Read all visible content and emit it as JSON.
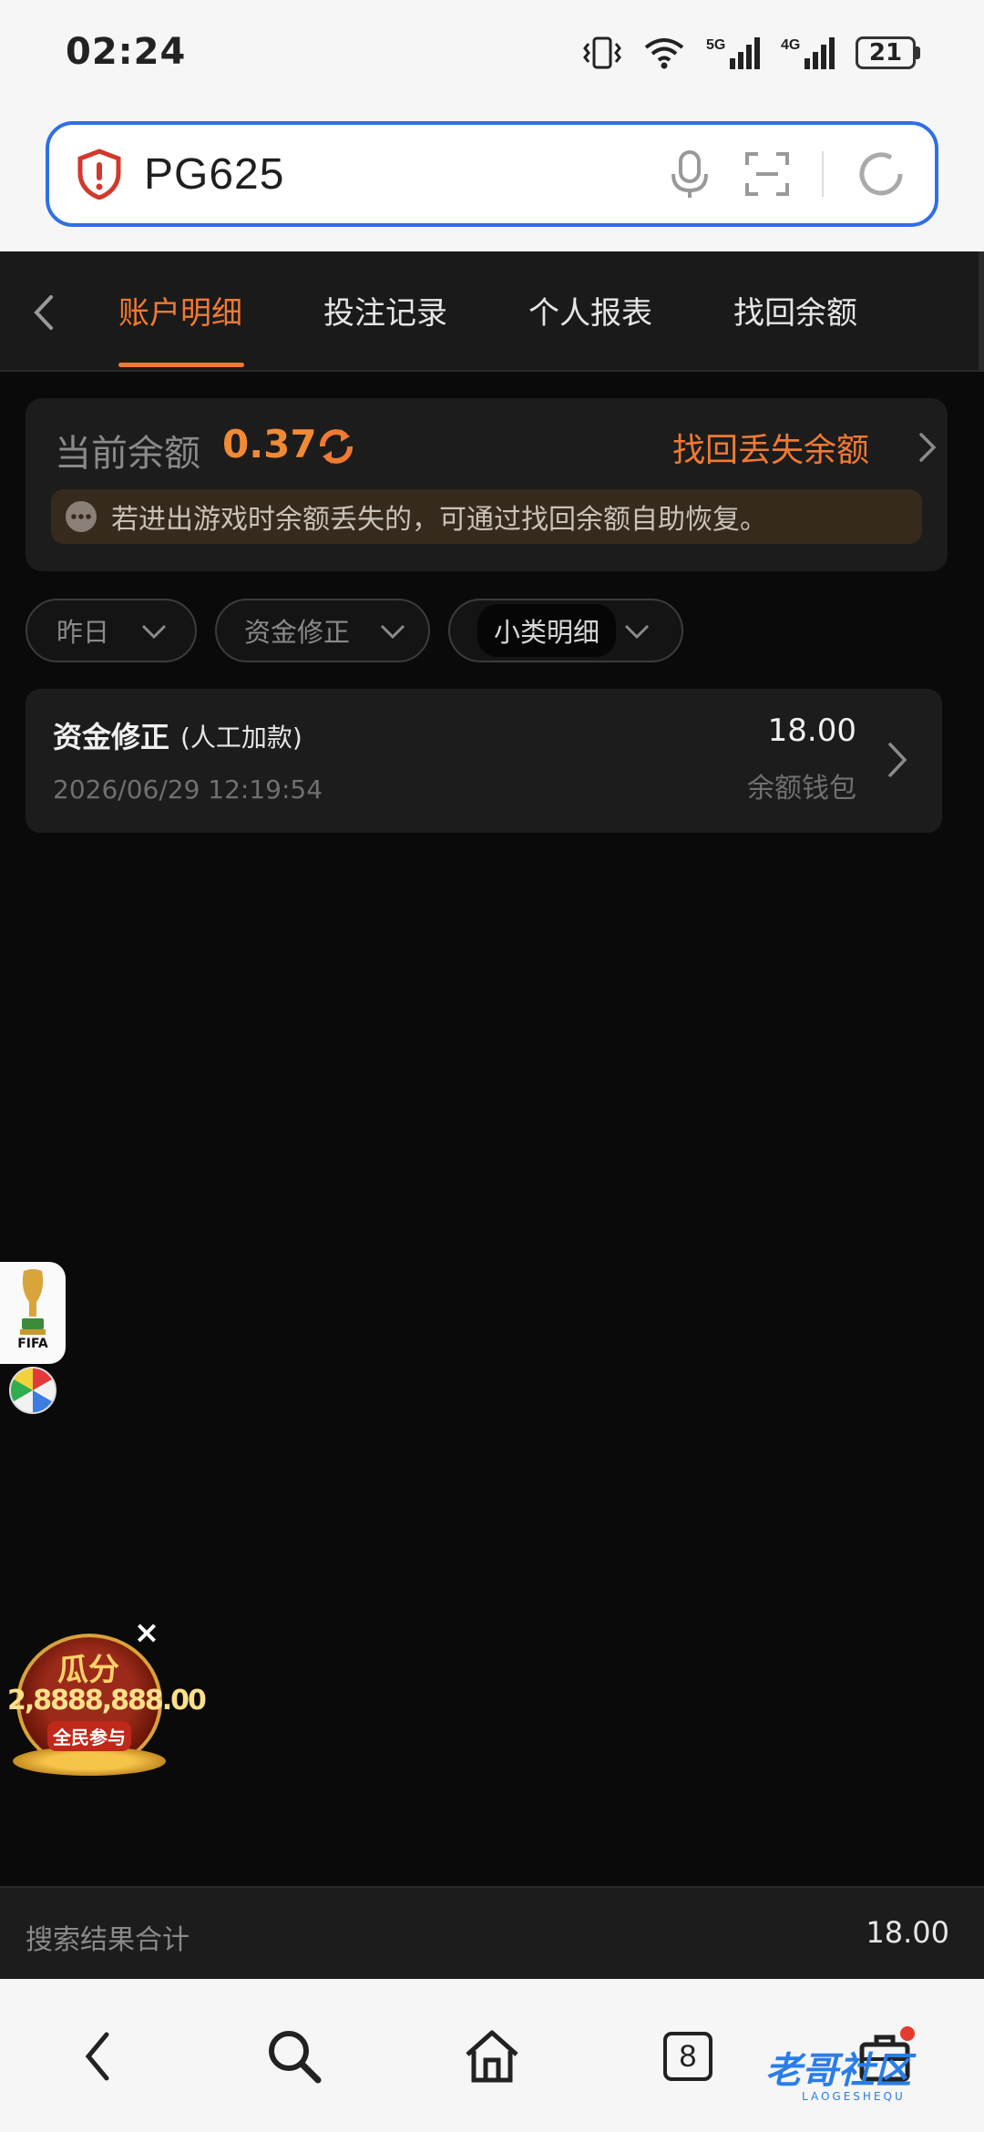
{
  "status_bar": {
    "time": "02:24",
    "battery": "21"
  },
  "browser": {
    "url": "PG625",
    "tab_count": "8"
  },
  "tabs": [
    "账户明细",
    "投注记录",
    "个人报表",
    "找回余额"
  ],
  "balance": {
    "label": "当前余额",
    "value": "0.37",
    "recover_link": "找回丢失余额",
    "notice": "若进出游戏时余额丢失的，可通过找回余额自助恢复。"
  },
  "filters": [
    "昨日",
    "资金修正",
    "小类明细"
  ],
  "records": [
    {
      "title": "资金修正",
      "subtitle": "(人工加款)",
      "date": "2026/06/29 12:19:54",
      "amount": "18.00",
      "wallet": "余额钱包"
    }
  ],
  "promo": {
    "line1": "瓜分",
    "line2": "2,8888,888.00",
    "line3": "全民参与"
  },
  "fifa_label": "FIFA",
  "summary": {
    "label": "搜索结果合计",
    "value": "18.00"
  },
  "watermark": {
    "text": "老哥社区",
    "sub": "LAOGESHEQU"
  },
  "colors": {
    "accent": "#f07a33",
    "background": "#0a0a0a",
    "card": "#1c1c1c",
    "url_border": "#2f6fe6"
  }
}
